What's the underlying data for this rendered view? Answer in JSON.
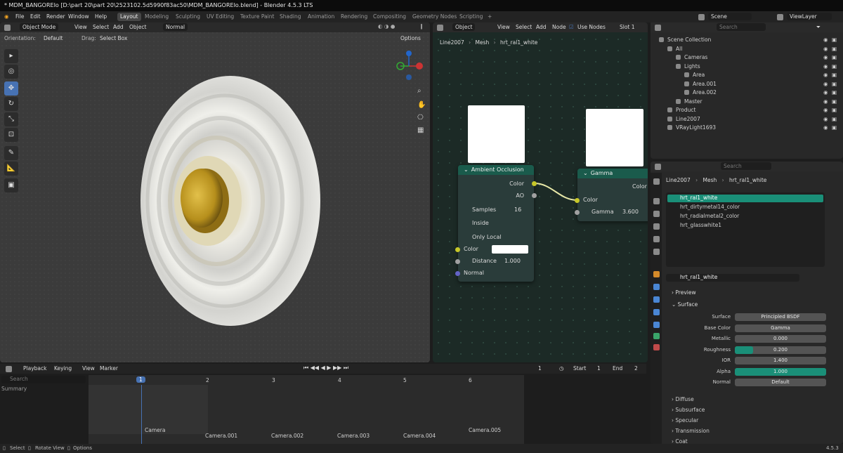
{
  "app": {
    "title": "* MDM_BANGOREIo [D:\\part 20\\part 20\\2523102.5d5990f83ac50\\MDM_BANGOREIo.blend] - Blender 4.5.3 LTS"
  },
  "menu": [
    "File",
    "Edit",
    "Render",
    "Window",
    "Help"
  ],
  "workspaces": [
    "Layout",
    "Modeling",
    "Sculpting",
    "UV Editing",
    "Texture Paint",
    "Shading",
    "Animation",
    "Rendering",
    "Compositing",
    "Geometry Nodes",
    "Scripting"
  ],
  "scene": {
    "label": "Scene",
    "viewlayer": "ViewLayer"
  },
  "viewport": {
    "mode": "Object Mode",
    "menus": [
      "View",
      "Select",
      "Add",
      "Object"
    ],
    "shading": "Normal",
    "orientation_label": "Orientation:",
    "orientation": "Default",
    "drag_label": "Drag:",
    "drag": "Select Box",
    "options": "Options"
  },
  "node_editor": {
    "type": "Object",
    "menus": [
      "View",
      "Select",
      "Add",
      "Node"
    ],
    "use_nodes": "Use Nodes",
    "slot": "Slot 1",
    "breadcrumb": [
      "Line2007",
      "Mesh",
      "hrt_ral1_white"
    ],
    "ao_node": {
      "title": "Ambient Occlusion",
      "out_color": "Color",
      "out_ao": "AO",
      "samples_label": "Samples",
      "samples": "16",
      "inside": "Inside",
      "only_local": "Only Local",
      "in_color": "Color",
      "distance_label": "Distance",
      "distance": "1.000",
      "normal": "Normal"
    },
    "gamma_node": {
      "title": "Gamma",
      "out_color": "Color",
      "in_color": "Color",
      "gamma_label": "Gamma",
      "gamma": "3.600"
    }
  },
  "timeline": {
    "menus": [
      "Playback",
      "Keying",
      "View",
      "Marker"
    ],
    "current_frame": "1",
    "start_label": "Start",
    "start": "1",
    "end_label": "End",
    "end": "2",
    "search_placeholder": "Search",
    "summary": "Summary",
    "frames": [
      "1",
      "2",
      "3",
      "4",
      "5",
      "6"
    ],
    "markers": [
      "Camera",
      "Camera.001",
      "Camera.002",
      "Camera.003",
      "Camera.004",
      "Camera.005"
    ]
  },
  "outliner": {
    "search_placeholder": "Search",
    "rows": [
      {
        "label": "Scene Collection",
        "indent": 0
      },
      {
        "label": "All",
        "indent": 1
      },
      {
        "label": "Cameras",
        "indent": 2
      },
      {
        "label": "Lights",
        "indent": 2
      },
      {
        "label": "Area",
        "indent": 3
      },
      {
        "label": "Area.001",
        "indent": 3
      },
      {
        "label": "Area.002",
        "indent": 3
      },
      {
        "label": "Master",
        "indent": 2
      },
      {
        "label": "Product",
        "indent": 1
      },
      {
        "label": "Line2007",
        "indent": 1
      },
      {
        "label": "VRayLight1693",
        "indent": 1
      }
    ]
  },
  "properties": {
    "search_placeholder": "Search",
    "breadcrumb": [
      "Line2007",
      "Mesh",
      "hrt_ral1_white"
    ],
    "materials": [
      "hrt_ral1_white",
      "hrt_dirtymetal14_color",
      "hrt_radialmetal2_color",
      "hrt_glasswhite1"
    ],
    "material_name": "hrt_ral1_white",
    "preview": "Preview",
    "surface_panel": "Surface",
    "fields": [
      {
        "label": "Surface",
        "value": "Principled BSDF"
      },
      {
        "label": "Base Color",
        "value": "Gamma"
      },
      {
        "label": "Metallic",
        "value": "0.000"
      },
      {
        "label": "Roughness",
        "value": "0.200",
        "fill": 0.2
      },
      {
        "label": "IOR",
        "value": "1.400"
      },
      {
        "label": "Alpha",
        "value": "1.000",
        "fill": 1.0
      },
      {
        "label": "Normal",
        "value": "Default"
      }
    ],
    "subpanels": [
      "Diffuse",
      "Subsurface",
      "Specular",
      "Transmission",
      "Coat"
    ]
  },
  "status": {
    "select": "Select",
    "rotate": "Rotate View",
    "options": "Options",
    "version": "4.5.3"
  },
  "colors": {
    "accent": "#1a8f78",
    "select_blue": "#4772b3",
    "node_header": "#1a5b4c"
  }
}
